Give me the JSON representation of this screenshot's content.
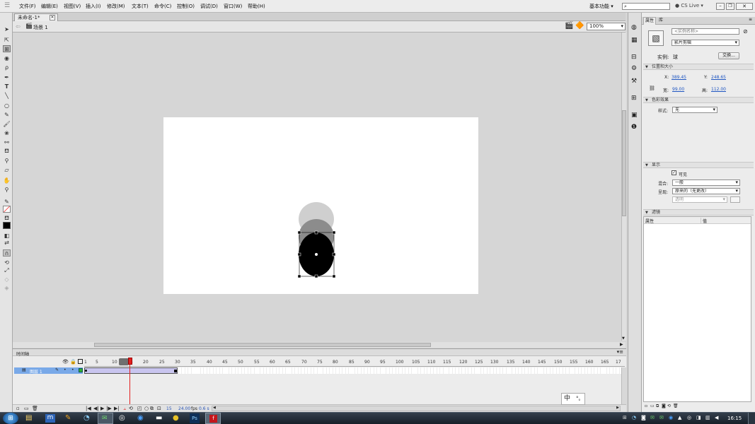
{
  "menubar": {
    "items": [
      "文件(F)",
      "编辑(E)",
      "视图(V)",
      "插入(I)",
      "修改(M)",
      "文本(T)",
      "命令(C)",
      "控制(O)",
      "调试(D)",
      "窗口(W)",
      "帮助(H)"
    ],
    "workspace": "基本功能",
    "cs_live": "CS Live"
  },
  "document": {
    "tab_label": "未命名-1*",
    "scene_label": "场景 1",
    "zoom": "100%"
  },
  "timeline": {
    "panel_title": "时间轴",
    "layer_name": "图层 1",
    "ruler_numbers": [
      "1",
      "5",
      "10",
      "15",
      "20",
      "25",
      "30",
      "35",
      "40",
      "45",
      "50",
      "55",
      "60",
      "65",
      "70",
      "75",
      "80",
      "85",
      "90",
      "95",
      "100",
      "105",
      "110",
      "115",
      "120",
      "125",
      "130",
      "135",
      "140",
      "145",
      "150",
      "155",
      "160",
      "165",
      "17"
    ],
    "current_frame": "15",
    "frame_rate": "24.00",
    "fps_unit": "fps",
    "elapsed": "0.6 s"
  },
  "properties": {
    "tab_properties": "属性",
    "tab_library": "库",
    "instance_name_placeholder": "<实例名称>",
    "symbol_type": "影片剪辑",
    "instance_label": "实例:",
    "instance_value": "球",
    "swap_button": "交换...",
    "section_position": "位置和大小",
    "x_label": "X:",
    "x_value": "389.45",
    "y_label": "Y:",
    "y_value": "248.65",
    "w_label": "宽:",
    "w_value": "99.00",
    "h_label": "高:",
    "h_value": "112.00",
    "section_color": "色彩效果",
    "style_label": "样式:",
    "style_value": "无",
    "section_display": "显示",
    "visible_label": "可见",
    "blend_label": "混合:",
    "blend_value": "一般",
    "render_label": "呈现:",
    "render_value": "原来的（无更改）",
    "transparent_value": "透明",
    "section_filters": "滤镜",
    "filter_col_property": "属性",
    "filter_col_value": "值"
  },
  "ime": {
    "char": "中",
    "punct": "°。"
  },
  "taskbar": {
    "clock": "16:15"
  },
  "colors": {
    "stage": "#ffffff",
    "layer_highlight": "#79a9e8",
    "tween_span": "#c9c5ef",
    "playhead": "#e31f1f",
    "link_blue": "#1f56c2"
  }
}
